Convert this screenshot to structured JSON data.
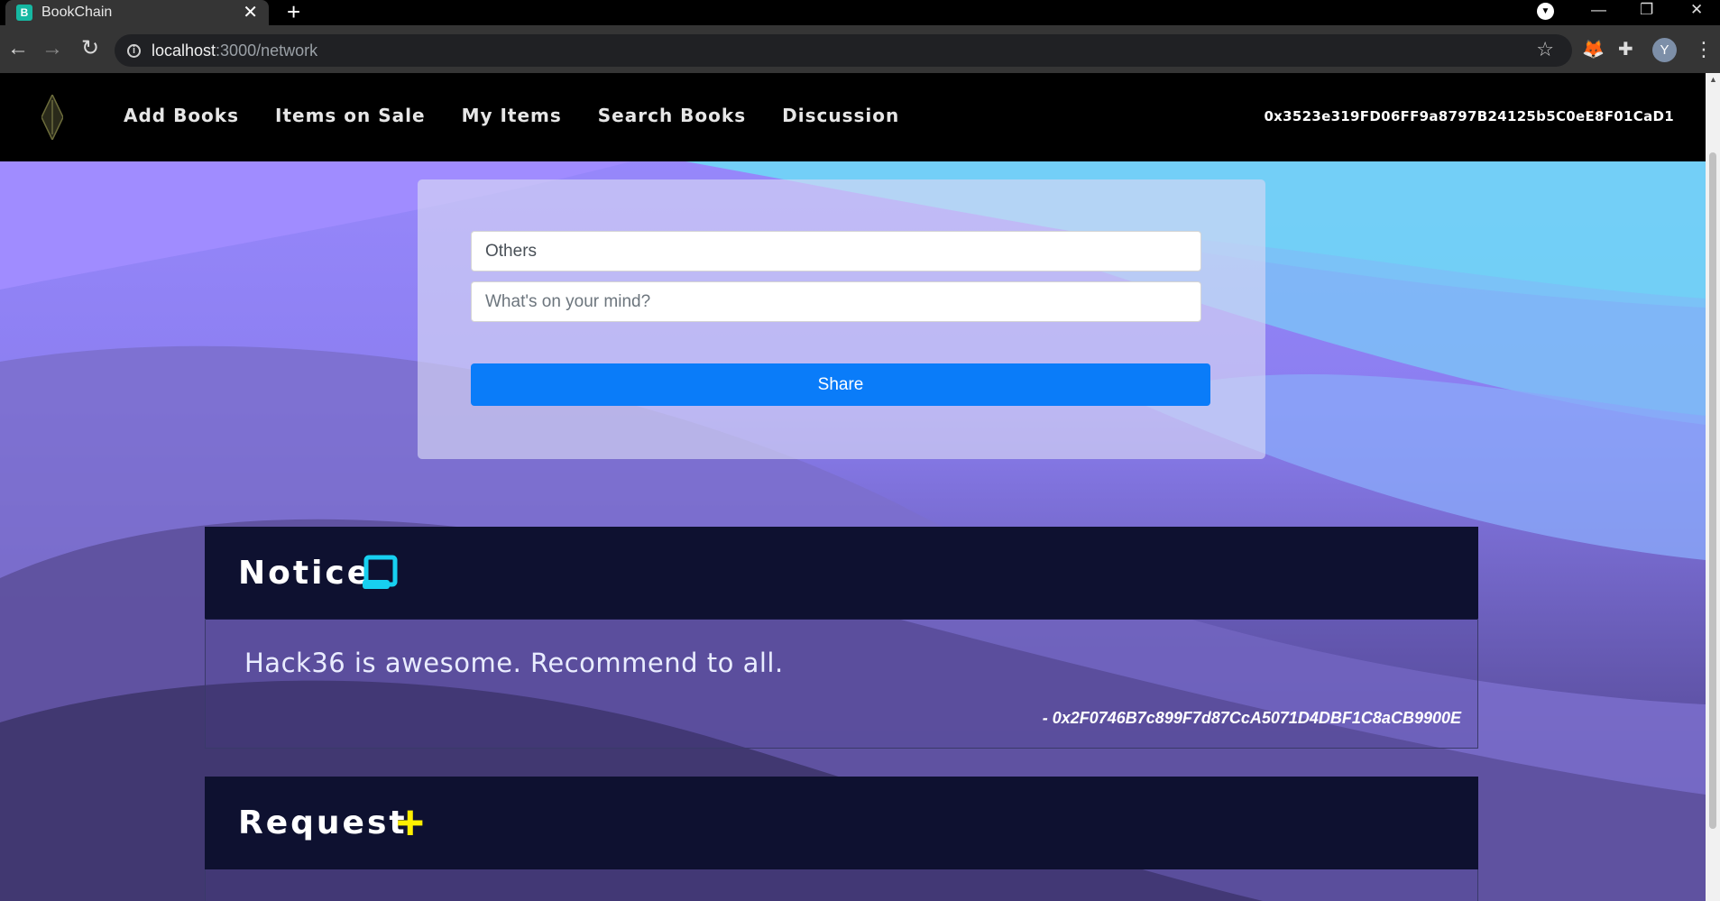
{
  "browser": {
    "tab_title": "BookChain",
    "favicon_letter": "B",
    "new_tab": "+",
    "url_host": "localhost",
    "url_path": ":3000/network",
    "profile_initial": "Y"
  },
  "nav": {
    "links": [
      "Add Books",
      "Items on Sale",
      "My Items",
      "Search Books",
      "Discussion"
    ],
    "wallet_address": "0x3523e319FD06FF9a8797B24125b5C0eE8F01CaD1"
  },
  "post_form": {
    "category_value": "Others",
    "message_placeholder": "What's on your mind?",
    "share_label": "Share"
  },
  "notice": {
    "title": "Notice",
    "icon": "scroll-icon",
    "message": "Hack36 is awesome. Recommend to all.",
    "author": "- 0x2F0746B7c899F7d87CcA5071D4DBF1C8aCB9900E"
  },
  "request": {
    "title": "Request",
    "icon": "plus-icon"
  },
  "colors": {
    "nav_bg": "#000000",
    "share_button": "#0a7cf9",
    "section_header": "#0e1130",
    "notice_icon": "#17d0f0",
    "plus_icon": "#ffef00"
  }
}
